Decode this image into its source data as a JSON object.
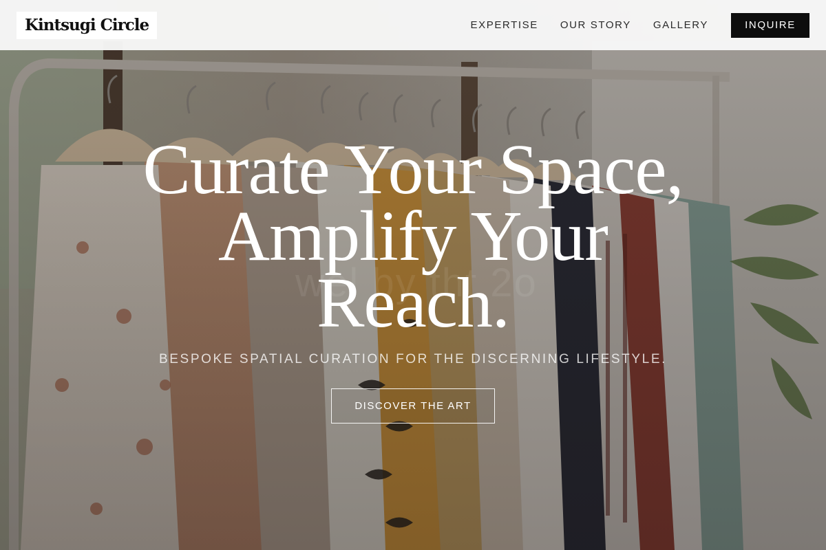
{
  "header": {
    "logo": "Kintsugi Circle",
    "nav": [
      "EXPERTISE",
      "OUR STORY",
      "GALLERY"
    ],
    "cta": "INQUIRE"
  },
  "hero": {
    "heading_line1": "Curate Your Space,",
    "heading_line2": "Amplify Your",
    "heading_line3": "Reach.",
    "watermark": "wel by tht 2o",
    "subtitle": "BESPOKE SPATIAL CURATION FOR THE DISCERNING LIFESTYLE.",
    "button": "DISCOVER THE ART"
  },
  "background": {
    "description_icon": "clothing-rack-photo",
    "colors": {
      "wall": "#9a9389",
      "window": "#b9bfb0",
      "rack": "#b5b0a8",
      "hanger": "#d8c3a5",
      "overlay": "#231c17"
    }
  }
}
